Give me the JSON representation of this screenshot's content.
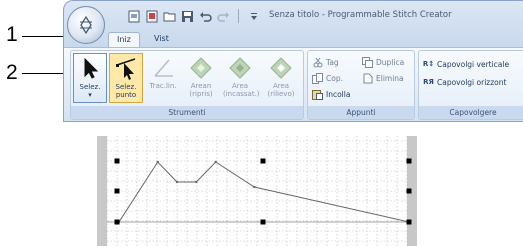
{
  "callouts": {
    "one": "1",
    "two": "2"
  },
  "window": {
    "title": "Senza titolo - Programmable Stitch Creator"
  },
  "tabs": [
    {
      "label": "Iniz"
    },
    {
      "label": "Vist"
    }
  ],
  "ribbon": {
    "strumenti": {
      "title": "Strumenti",
      "selez": {
        "label": "Selez.",
        "arrow": "▾"
      },
      "selez_punto": {
        "label_1": "Selez.",
        "label_2": "punto"
      },
      "trac_lin": {
        "label": "Trac.lin."
      },
      "arean": {
        "label_1": "Arean",
        "label_2": "(ripris)"
      },
      "area_incassat": {
        "label_1": "Area",
        "label_2": "(incassat.)"
      },
      "area_rilievo": {
        "label_1": "Area",
        "label_2": "(rilievo)"
      }
    },
    "appunti": {
      "title": "Appunti",
      "tag": "Tag",
      "duplica": "Duplica",
      "cop": "Cop.",
      "elimina": "Elimina",
      "incolla": "Incolla"
    },
    "capovolgere": {
      "title": "Capovolgere",
      "verticale": "Capovolgi verticale",
      "orizzontale": "Capovolgi orizzont"
    }
  },
  "colors": {
    "accent": "#6b8fc0",
    "selected": "#ffe9a8",
    "grid_side": "#c8c8c8"
  },
  "stitch_points": [
    {
      "x": 0,
      "y": 0
    },
    {
      "x": 4,
      "y": 6
    },
    {
      "x": 6,
      "y": 4
    },
    {
      "x": 8,
      "y": 4
    },
    {
      "x": 10,
      "y": 6
    },
    {
      "x": 14,
      "y": 3.5
    },
    {
      "x": 30,
      "y": 0
    }
  ]
}
